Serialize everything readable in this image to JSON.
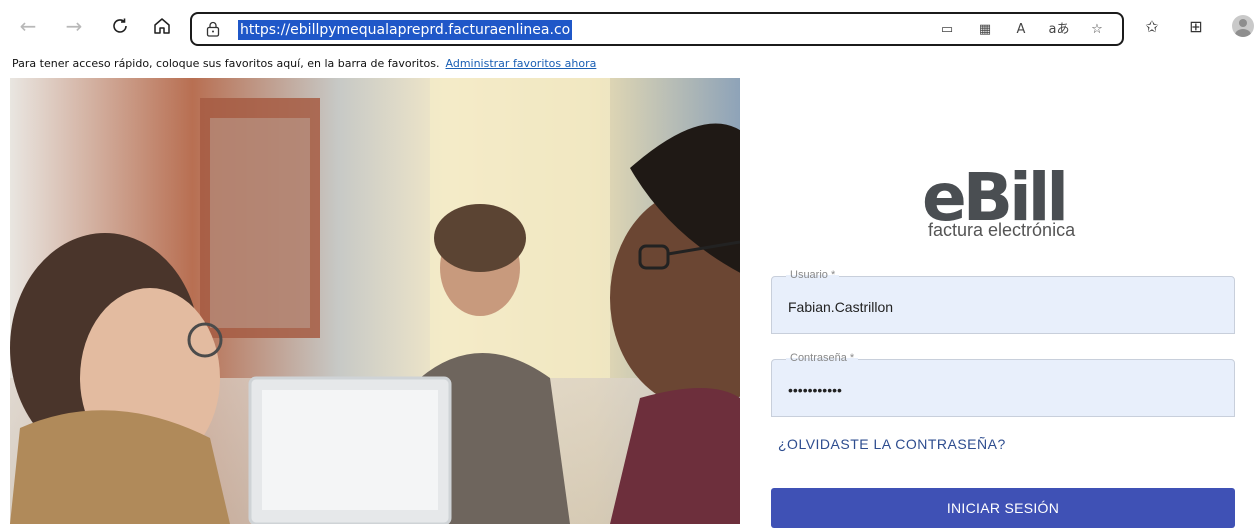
{
  "browser": {
    "url": "https://ebillpymequalapreprd.facturaenlinea.co",
    "icons": [
      "back-icon",
      "forward-icon",
      "refresh-icon",
      "home-icon",
      "lock-icon",
      "immersive-reader-icon",
      "qr-code-icon",
      "read-aloud-icon",
      "translate-icon",
      "add-favorite-icon",
      "favorites-icon",
      "collections-icon",
      "profile-icon"
    ]
  },
  "favorites_bar": {
    "message": "Para tener acceso rápido, coloque sus favoritos aquí, en la barra de favoritos.",
    "link": "Administrar favoritos ahora"
  },
  "login": {
    "logo_text": "eBill",
    "logo_subtitle": "factura electrónica",
    "username_label": "Usuario *",
    "username_value": "Fabian.Castrillon",
    "password_label": "Contraseña *",
    "password_value": "•••••••••••",
    "forgot_password": "¿OLVIDASTE LA CONTRASEÑA?",
    "submit": "INICIAR SESIÓN"
  },
  "colors": {
    "primary": "#3f51b5",
    "field_bg": "#e8effb",
    "link": "#2e4d8f",
    "logo": "#4a4e52",
    "url_highlight": "#1f57c8"
  }
}
